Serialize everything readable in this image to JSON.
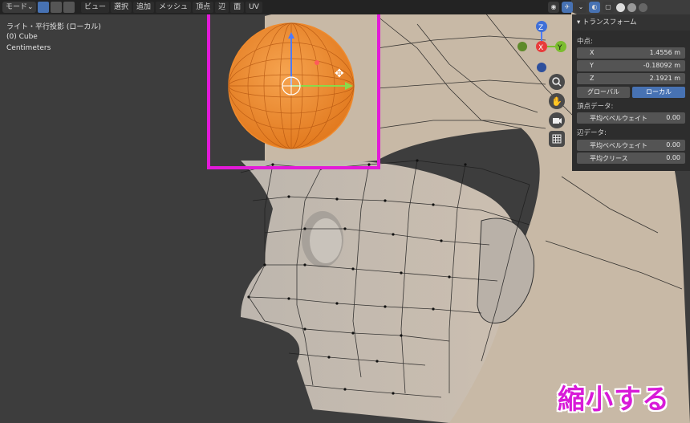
{
  "header": {
    "mode_label": "モード",
    "menus": [
      "ビュー",
      "選択",
      "追加",
      "メッシュ",
      "頂点",
      "辺",
      "面",
      "UV"
    ]
  },
  "viewport_info": {
    "projection": "ライト・平行投影 (ローカル)",
    "object": "(0) Cube",
    "units": "Centimeters"
  },
  "gizmo": {
    "z": "Z",
    "x": "X",
    "y": "Y"
  },
  "panel": {
    "title": "トランスフォーム",
    "median_label": "中点:",
    "x_label": "X",
    "x_value": "1.4556 m",
    "y_label": "Y",
    "y_value": "-0.18092 m",
    "z_label": "Z",
    "z_value": "2.1921 m",
    "global_label": "グローバル",
    "local_label": "ローカル",
    "vertex_data_label": "頂点データ:",
    "vertex_bevel_label": "平均ベベルウェイト",
    "vertex_bevel_value": "0.00",
    "edge_data_label": "辺データ:",
    "edge_bevel_label": "平均ベベルウェイト",
    "edge_bevel_value": "0.00",
    "crease_label": "平均クリース",
    "crease_value": "0.00"
  },
  "caption": "縮小する",
  "colors": {
    "highlight": "#e21ad8",
    "selected_mesh": "#f08a2c",
    "accent": "#4772b3"
  }
}
